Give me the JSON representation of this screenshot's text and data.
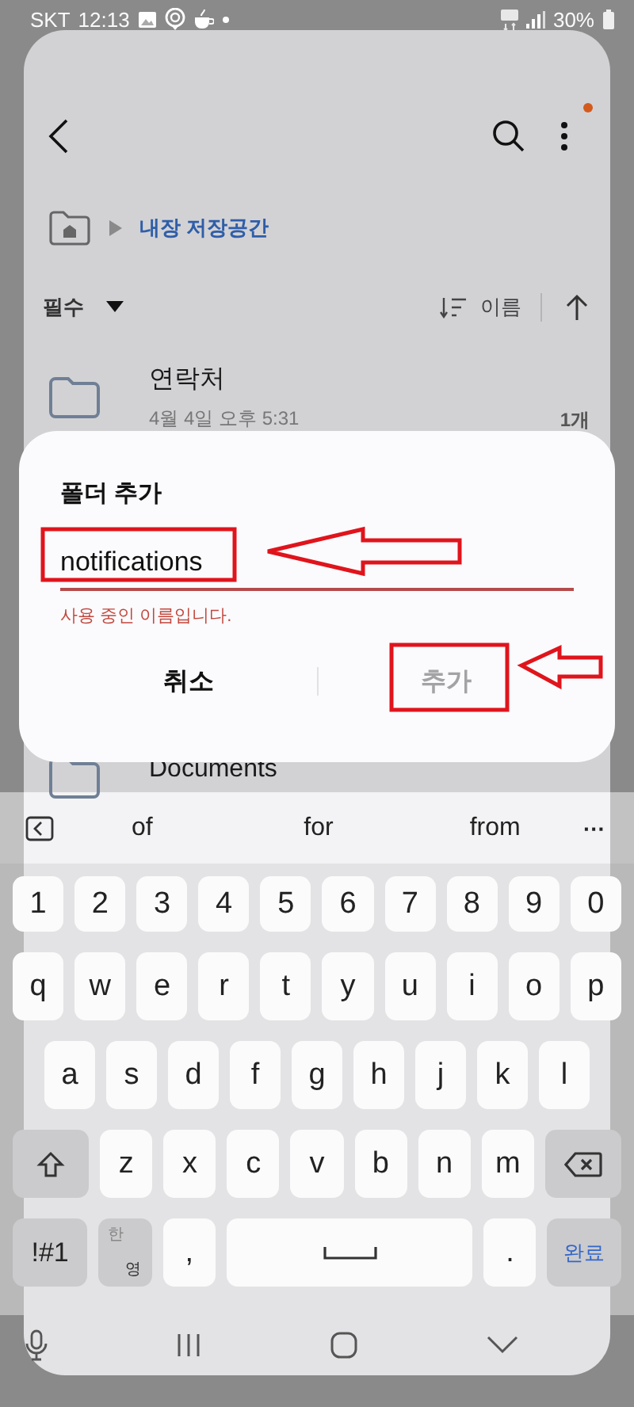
{
  "status_bar": {
    "carrier": "SKT",
    "time": "12:13",
    "battery": "30%"
  },
  "app_bar": {
    "menu_badge": true
  },
  "breadcrumb": {
    "label": "내장 저장공간"
  },
  "sort": {
    "filter": "필수",
    "sort_by": "이름"
  },
  "folders": [
    {
      "name": "연락처",
      "date": "4월 4일 오후 5:31",
      "count": "1개"
    },
    {
      "name": "Documents"
    }
  ],
  "dialog": {
    "title": "폴더 추가",
    "value": "notifications",
    "error": "사용 중인 이름입니다.",
    "buttons": [
      {
        "label": "취소",
        "disabled": false
      },
      {
        "label": "추가",
        "disabled": true
      }
    ]
  },
  "keyboard": {
    "suggestions": [
      "of",
      "for",
      "from"
    ],
    "more": "···",
    "rows": [
      [
        "1",
        "2",
        "3",
        "4",
        "5",
        "6",
        "7",
        "8",
        "9",
        "0"
      ],
      [
        "q",
        "w",
        "e",
        "r",
        "t",
        "y",
        "u",
        "i",
        "o",
        "p"
      ],
      [
        "a",
        "s",
        "d",
        "f",
        "g",
        "h",
        "j",
        "k",
        "l"
      ],
      [
        "z",
        "x",
        "c",
        "v",
        "b",
        "n",
        "m"
      ]
    ],
    "symbols": "!#1",
    "lang_top": "한",
    "lang_bottom": "영",
    "comma": ",",
    "period": ".",
    "done": "완료"
  }
}
